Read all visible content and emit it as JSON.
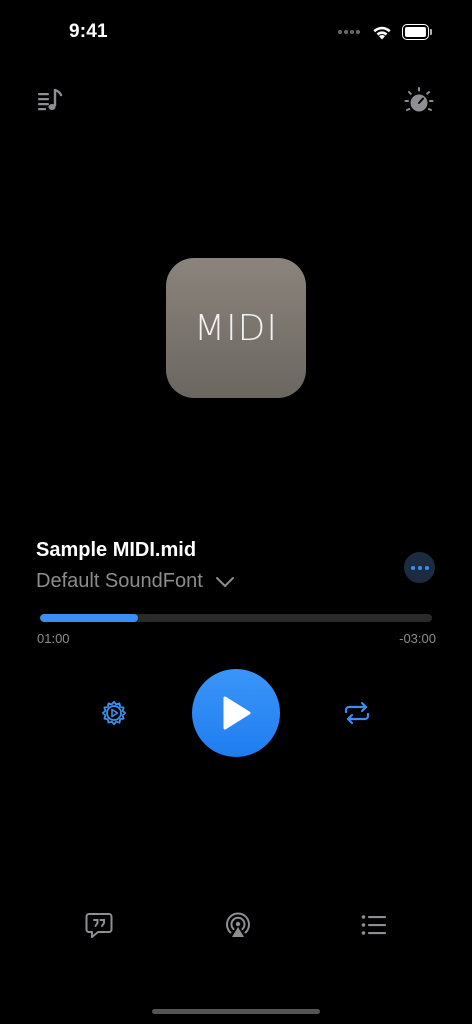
{
  "status_bar": {
    "time": "9:41"
  },
  "top_bar": {
    "left_icon": "playlist-music-icon",
    "right_icon": "tempo-dial-icon"
  },
  "artwork": {
    "label": "MIDI"
  },
  "track": {
    "title": "Sample MIDI.mid",
    "soundfont": "Default SoundFont"
  },
  "playback": {
    "progress": 0.25,
    "elapsed": "01:00",
    "remaining": "-03:00"
  },
  "controls": {
    "left_icon": "speed-gear-icon",
    "center_icon": "play-icon",
    "right_icon": "repeat-icon"
  },
  "bottom_bar": {
    "icons": [
      "lyrics-icon",
      "airplay-icon",
      "queue-list-icon"
    ]
  },
  "colors": {
    "background": "#000000",
    "accent": "#3A8FF0",
    "secondary_text": "#8C8C8C",
    "icon_gray": "#8E8E93",
    "artwork_top": "#8A847D",
    "artwork_bottom": "#6B665F"
  }
}
